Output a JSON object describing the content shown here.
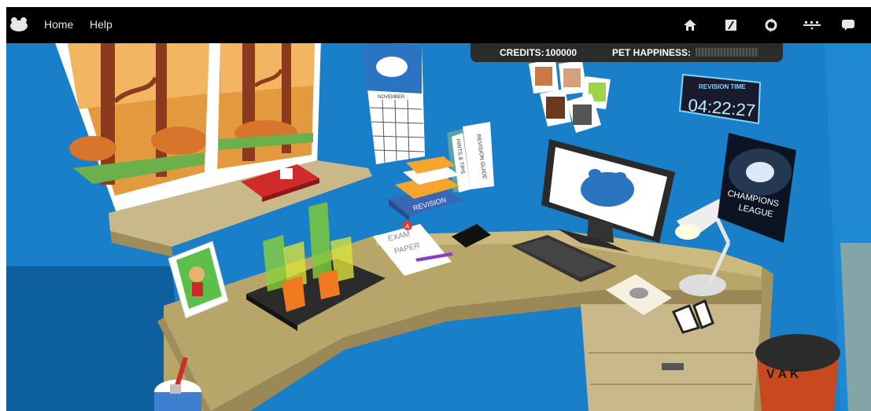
{
  "nav": {
    "home": "Home",
    "help": "Help"
  },
  "toolbar_icons": [
    "house-icon",
    "flip-icon",
    "recycle-icon",
    "sliders-icon",
    "chat-icon"
  ],
  "status": {
    "credits_label": "CREDITS:",
    "credits_value": "100000",
    "happiness_label": "PET HAPPINESS:",
    "happiness_level": 0
  },
  "room": {
    "calendar_month": "NOVEMBER",
    "clock_title": "REVISION TIME",
    "clock_time": "04:22:27",
    "poster_line1": "CHAMPIONS",
    "poster_line2": "LEAGUE",
    "book_spine_1": "REVISION GUIDE",
    "book_spine_2": "HINTS & TIPS",
    "book_revision": "REVISION",
    "exam_line1": "EXAM",
    "exam_line2": "PAPER",
    "exam_grade": "A",
    "bin_letters": "V A K"
  },
  "colors": {
    "wall": "#1a7fc9",
    "desk": "#b8a56a",
    "topbar": "#000000"
  }
}
